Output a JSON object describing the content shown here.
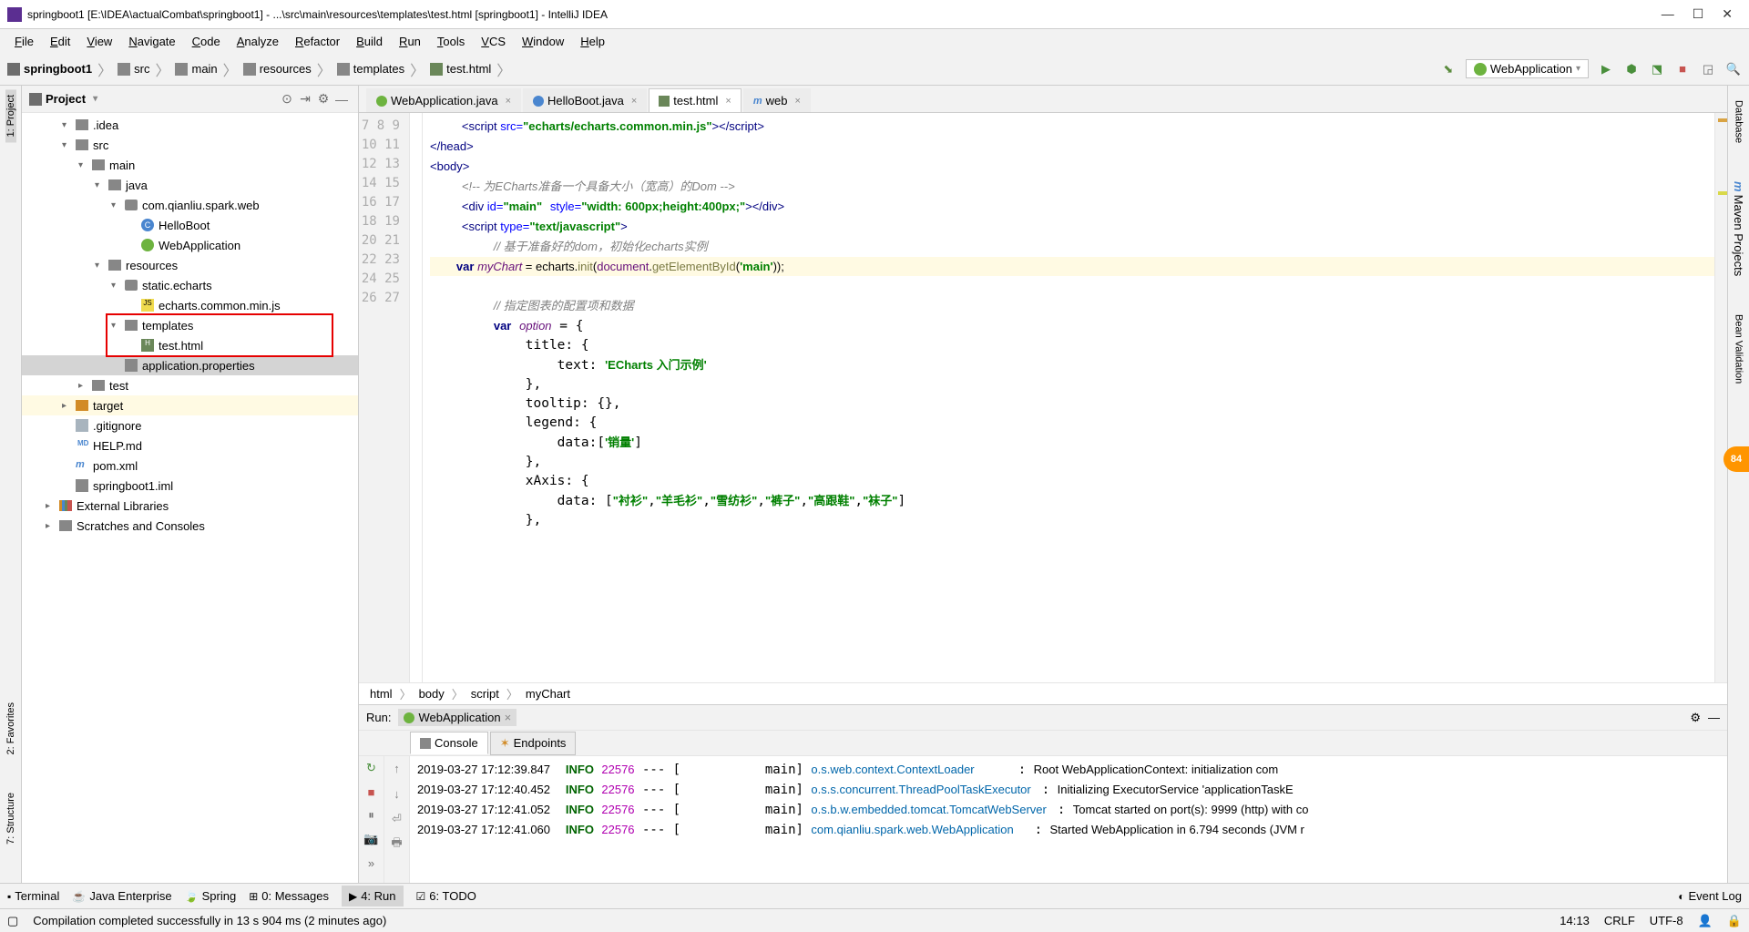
{
  "window": {
    "title": "springboot1 [E:\\IDEA\\actualCombat\\springboot1] - ...\\src\\main\\resources\\templates\\test.html [springboot1] - IntelliJ IDEA"
  },
  "menu": [
    "File",
    "Edit",
    "View",
    "Navigate",
    "Code",
    "Analyze",
    "Refactor",
    "Build",
    "Run",
    "Tools",
    "VCS",
    "Window",
    "Help"
  ],
  "breadcrumb": [
    "springboot1",
    "src",
    "main",
    "resources",
    "templates",
    "test.html"
  ],
  "run_config": "WebApplication",
  "project": {
    "title": "Project",
    "tree": [
      {
        "d": 2,
        "a": "▾",
        "ic": "dir",
        "t": ".idea"
      },
      {
        "d": 2,
        "a": "▾",
        "ic": "dir",
        "t": "src"
      },
      {
        "d": 3,
        "a": "▾",
        "ic": "dir",
        "t": "main"
      },
      {
        "d": 4,
        "a": "▾",
        "ic": "dir",
        "t": "java"
      },
      {
        "d": 5,
        "a": "▾",
        "ic": "pkg",
        "t": "com.qianliu.spark.web"
      },
      {
        "d": 6,
        "a": "",
        "ic": "cls",
        "t": "HelloBoot"
      },
      {
        "d": 6,
        "a": "",
        "ic": "sb",
        "t": "WebApplication"
      },
      {
        "d": 4,
        "a": "▾",
        "ic": "dir",
        "t": "resources"
      },
      {
        "d": 5,
        "a": "▾",
        "ic": "pkg",
        "t": "static.echarts"
      },
      {
        "d": 6,
        "a": "",
        "ic": "js",
        "t": "echarts.common.min.js"
      },
      {
        "d": 5,
        "a": "▾",
        "ic": "dir",
        "t": "templates",
        "box": true
      },
      {
        "d": 6,
        "a": "",
        "ic": "html",
        "t": "test.html",
        "box": true
      },
      {
        "d": 5,
        "a": "",
        "ic": "prop",
        "t": "application.properties",
        "sel": true
      },
      {
        "d": 3,
        "a": "▸",
        "ic": "dir",
        "t": "test"
      },
      {
        "d": 2,
        "a": "▸",
        "ic": "dir-o",
        "t": "target",
        "hl": true
      },
      {
        "d": 2,
        "a": "",
        "ic": "txt",
        "t": ".gitignore"
      },
      {
        "d": 2,
        "a": "",
        "ic": "md",
        "t": "HELP.md"
      },
      {
        "d": 2,
        "a": "",
        "ic": "mvn",
        "t": "pom.xml"
      },
      {
        "d": 2,
        "a": "",
        "ic": "prop",
        "t": "springboot1.iml"
      },
      {
        "d": 1,
        "a": "▸",
        "ic": "lib",
        "t": "External Libraries"
      },
      {
        "d": 1,
        "a": "▸",
        "ic": "dir",
        "t": "Scratches and Consoles"
      }
    ]
  },
  "editor": {
    "tabs": [
      {
        "ic": "sb",
        "label": "WebApplication.java"
      },
      {
        "ic": "cls",
        "label": "HelloBoot.java"
      },
      {
        "ic": "html",
        "label": "test.html",
        "active": true
      },
      {
        "ic": "m",
        "label": "web"
      }
    ],
    "line_start": 7,
    "line_end": 27,
    "code_lines": [
      "    <span class='tag'>&lt;script </span><span class='attr'>src=</span><span class='str'>\"echarts/echarts.common.min.js\"</span><span class='tag'>&gt;&lt;/script&gt;</span>",
      "<span class='tag'>&lt;/head&gt;</span>",
      "<span class='tag'>&lt;body&gt;</span>",
      "    <span class='cmt'>&lt;!-- 为ECharts准备一个具备大小（宽高）的Dom --&gt;</span>",
      "    <span class='tag'>&lt;div </span><span class='attr'>id=</span><span class='str'>\"main\"</span> <span class='attr'>style=</span><span class='str'>\"width: 600px;height:400px;\"</span><span class='tag'>&gt;&lt;/div&gt;</span>",
      "    <span class='tag'>&lt;script </span><span class='attr'>type=</span><span class='str'>\"text/javascript\"</span><span class='tag'>&gt;</span>",
      "        <span class='cmt'>// 基于准备好的dom，初始化echarts实例</span>",
      "        <span class='kw'>var</span> <span class='var'>myChart</span> = echarts.<span class='fn'>init</span>(<span class='obj'>document</span>.<span class='fn'>getElementById</span>(<span class='str'>'main'</span>));",
      "",
      "        <span class='cmt'>// 指定图表的配置项和数据</span>",
      "        <span class='kw'>var</span> <span class='var'>option</span> = {",
      "            title: {",
      "                text: <span class='str'>'ECharts 入门示例'</span>",
      "            },",
      "            tooltip: {},",
      "            legend: {",
      "                data:[<span class='str'>'销量'</span>]",
      "            },",
      "            xAxis: {",
      "                data: [<span class='str'>\"衬衫\"</span>,<span class='str'>\"羊毛衫\"</span>,<span class='str'>\"雪纺衫\"</span>,<span class='str'>\"裤子\"</span>,<span class='str'>\"高跟鞋\"</span>,<span class='str'>\"袜子\"</span>]",
      "            },"
    ],
    "crumbs": [
      "html",
      "body",
      "script",
      "myChart"
    ]
  },
  "run": {
    "label": "Run:",
    "config": "WebApplication",
    "tabs": [
      "Console",
      "Endpoints"
    ],
    "log": [
      {
        "ts": "2019-03-27 17:12:39.847",
        "lvl": "INFO",
        "pid": "22576",
        "th": "main",
        "cls": "o.s.web.context.ContextLoader",
        "msg": "Root WebApplicationContext: initialization com"
      },
      {
        "ts": "2019-03-27 17:12:40.452",
        "lvl": "INFO",
        "pid": "22576",
        "th": "main",
        "cls": "o.s.s.concurrent.ThreadPoolTaskExecutor",
        "msg": "Initializing ExecutorService 'applicationTaskE"
      },
      {
        "ts": "2019-03-27 17:12:41.052",
        "lvl": "INFO",
        "pid": "22576",
        "th": "main",
        "cls": "o.s.b.w.embedded.tomcat.TomcatWebServer",
        "msg": "Tomcat started on port(s): 9999 (http) with co"
      },
      {
        "ts": "2019-03-27 17:12:41.060",
        "lvl": "INFO",
        "pid": "22576",
        "th": "main",
        "cls": "com.qianliu.spark.web.WebApplication",
        "msg": "Started WebApplication in 6.794 seconds (JVM r"
      }
    ]
  },
  "bottom": {
    "items": [
      "Terminal",
      "Java Enterprise",
      "Spring",
      "0: Messages",
      "4: Run",
      "6: TODO"
    ],
    "eventlog": "Event Log"
  },
  "status": {
    "msg": "Compilation completed successfully in 13 s 904 ms (2 minutes ago)",
    "pos": "14:13",
    "le": "CRLF",
    "enc": "UTF-8"
  },
  "left_tabs": [
    "1: Project",
    "2: Favorites",
    "7: Structure"
  ],
  "right_tabs": [
    "Database",
    "Maven Projects",
    "Bean Validation"
  ],
  "badge": "84"
}
